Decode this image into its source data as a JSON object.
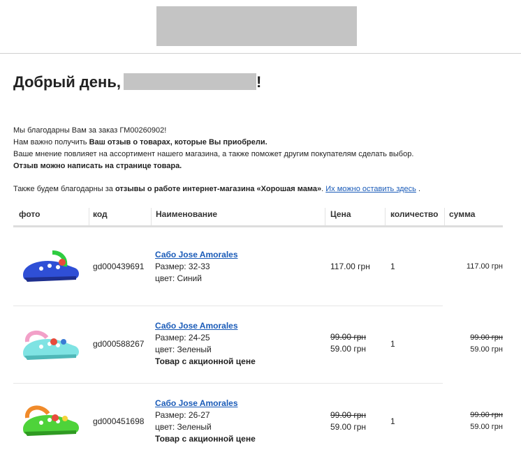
{
  "greeting": {
    "text": "Добрый день,",
    "suffix": "!"
  },
  "intro": {
    "line1": "Мы благодарны Вам за заказ ГМ00260902!",
    "line2_prefix": "Нам важно получить ",
    "line2_bold": "Ваш отзыв о товарах, которые Вы приобрели.",
    "line3": "Ваше мнение повлияет на ассортимент нашего магазина, а также поможет другим покупателям сделать выбор.",
    "line4_bold": "Отзыв можно написать на странице товара.",
    "line5_prefix": "Также будем благодарны за ",
    "line5_bold": "отзывы о работе интернет-магазина «Хорошая мама»",
    "line5_dot": ". ",
    "line5_link": "Их можно оставить здесь",
    "line5_end": " ."
  },
  "table": {
    "headers": {
      "photo": "фото",
      "code": "код",
      "name": "Наименование",
      "price": "Цена",
      "qty": "количество",
      "sum": "сумма"
    },
    "rows": [
      {
        "code": "gd000439691",
        "title": "Сабо Jose Amorales",
        "size": "Размер: 32-33",
        "color": "цвет: Синий",
        "promo": "",
        "old_price": "",
        "price": "117.00 грн",
        "qty": "1",
        "old_sum": "",
        "sum": "117.00 грн",
        "shoe_color": "#2f4fd6",
        "strap_color": "#2ecc40"
      },
      {
        "code": "gd000588267",
        "title": "Сабо Jose Amorales",
        "size": "Размер: 24-25",
        "color": "цвет: Зеленый",
        "promo": "Товар с акционной цене",
        "old_price": "99.00 грн",
        "price": "59.00 грн",
        "qty": "1",
        "old_sum": "99.00 грн",
        "sum": "59.00 грн",
        "shoe_color": "#7fe3e3",
        "strap_color": "#f2a0c8"
      },
      {
        "code": "gd000451698",
        "title": "Сабо Jose Amorales",
        "size": "Размер: 26-27",
        "color": "цвет: Зеленый",
        "promo": "Товар с акционной цене",
        "old_price": "99.00 грн",
        "price": "59.00 грн",
        "qty": "1",
        "old_sum": "99.00 грн",
        "sum": "59.00 грн",
        "shoe_color": "#4ed33a",
        "strap_color": "#f08a2a"
      }
    ]
  }
}
